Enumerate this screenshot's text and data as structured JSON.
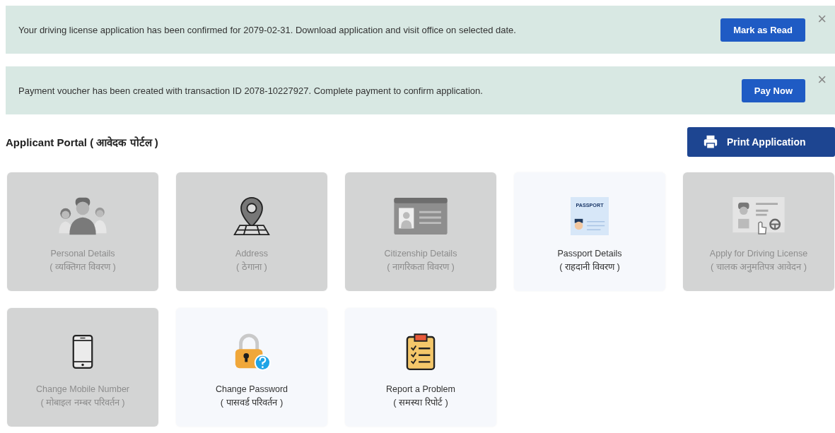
{
  "alerts": [
    {
      "message": "Your driving license application has been confirmed for 2079-02-31. Download application and visit office on selected date.",
      "action": "Mark as Read",
      "close": "×"
    },
    {
      "message": "Payment voucher has been created with transaction ID 2078-10227927. Complete payment to confirm application.",
      "action": "Pay Now",
      "close": "×"
    }
  ],
  "portal": {
    "title": "Applicant Portal ( आवेदक पोर्टल )",
    "print_button": "Print Application"
  },
  "cards": [
    {
      "kind": "people",
      "title": "Personal Details",
      "subtitle": "( व्यक्तिगत विवरण )",
      "disabled": true
    },
    {
      "kind": "location",
      "title": "Address",
      "subtitle": "( ठेगाना )",
      "disabled": true
    },
    {
      "kind": "idcard",
      "title": "Citizenship Details",
      "subtitle": "( नागरिकता विवरण )",
      "disabled": true
    },
    {
      "kind": "passport",
      "title": "Passport Details",
      "subtitle": "( राहदानी विवरण )",
      "disabled": false,
      "icon_text": "PASSPORT"
    },
    {
      "kind": "license",
      "title": "Apply for Driving License",
      "subtitle": "( चालक अनुमतिपत्र आवेदन )",
      "disabled": true
    },
    {
      "kind": "phone",
      "title": "Change Mobile Number",
      "subtitle": "( मोबाइल नम्बर परिवर्तन )",
      "disabled": true
    },
    {
      "kind": "lock",
      "title": "Change Password",
      "subtitle": "( पासवर्ड परिवर्तन )",
      "disabled": false
    },
    {
      "kind": "clipboard",
      "title": "Report a Problem",
      "subtitle": "( समस्या रिपोर्ट )",
      "disabled": false
    }
  ]
}
